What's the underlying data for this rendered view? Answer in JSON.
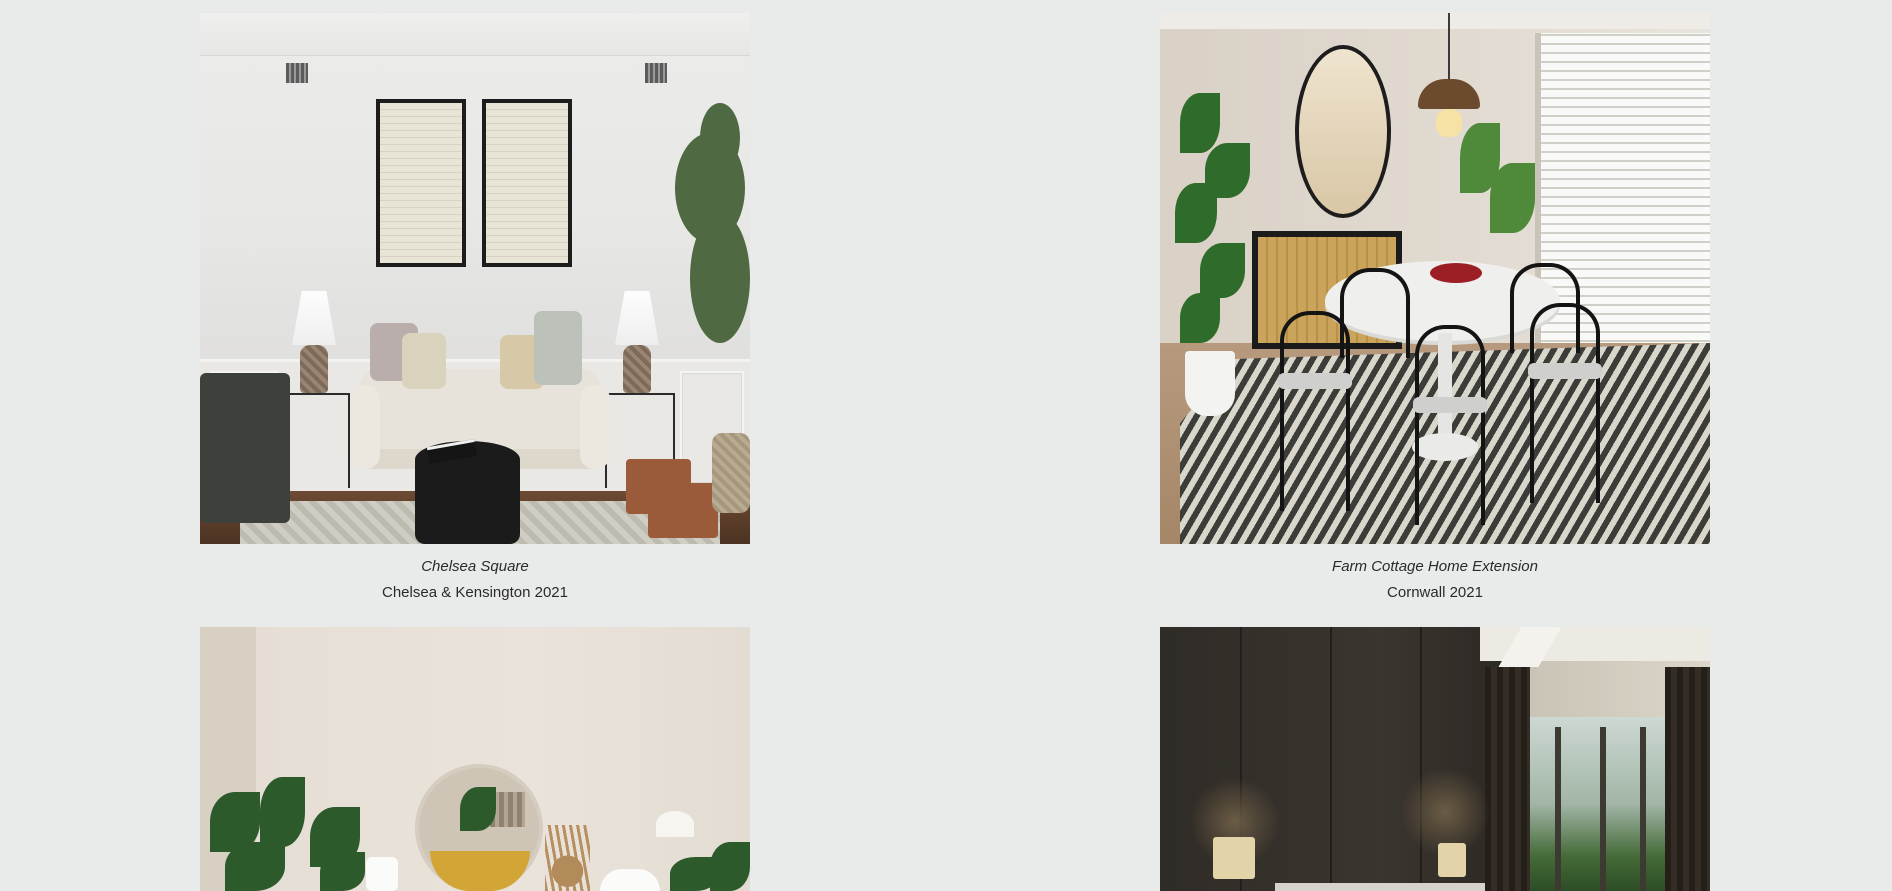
{
  "projects": [
    {
      "title": "Chelsea Square",
      "subtitle": "Chelsea & Kensington 2021",
      "image_alt": "Living room with beige sofa, framed art and black coffee table"
    },
    {
      "title": "Farm Cottage Home Extension",
      "subtitle": "Cornwall 2021",
      "image_alt": "Dining room with oval table, black chairs and round mirror"
    },
    {
      "title": "",
      "subtitle": "",
      "image_alt": "Living room with round mirror and plants"
    },
    {
      "title": "",
      "subtitle": "",
      "image_alt": "Dark bedroom with tall windows and curtains"
    }
  ],
  "colors": {
    "page_background": "#e9ebeb",
    "text": "#2a2a2a"
  }
}
